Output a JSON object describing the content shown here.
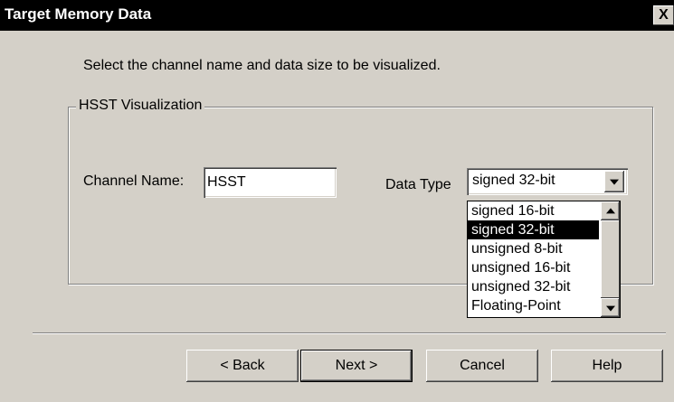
{
  "window": {
    "title": "Target Memory Data",
    "close_label": "X"
  },
  "instruction": "Select the channel name and data size to be visualized.",
  "group": {
    "label": "HSST Visualization",
    "channel_label": "Channel Name:",
    "channel_value": "HSST",
    "data_type_label": "Data Type",
    "data_type_selected": "signed 32-bit",
    "data_type_options": [
      "signed 16-bit",
      "signed 32-bit",
      "unsigned 8-bit",
      "unsigned 16-bit",
      "unsigned 32-bit",
      "Floating-Point"
    ],
    "highlighted_option": "signed 32-bit"
  },
  "buttons": {
    "back": "< Back",
    "next": "Next >",
    "cancel": "Cancel",
    "help": "Help"
  }
}
